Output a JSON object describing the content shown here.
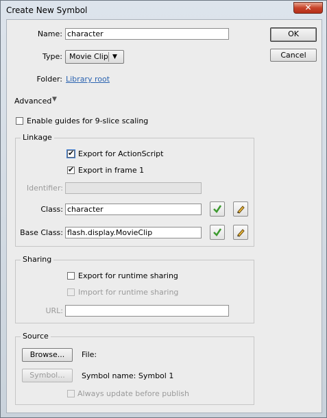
{
  "window": {
    "title": "Create New Symbol",
    "close_label": "✕"
  },
  "buttons": {
    "ok": "OK",
    "cancel": "Cancel"
  },
  "form": {
    "name_label": "Name:",
    "name_value": "character",
    "type_label": "Type:",
    "type_value": "Movie Clip",
    "folder_label": "Folder:",
    "folder_value": "Library root"
  },
  "advanced": {
    "label": "Advanced",
    "nine_slice": "Enable guides for 9-slice scaling"
  },
  "linkage": {
    "title": "Linkage",
    "export_actionscript": "Export for ActionScript",
    "export_frame1": "Export in frame 1",
    "identifier_label": "Identifier:",
    "identifier_value": "",
    "class_label": "Class:",
    "class_value": "character",
    "base_class_label": "Base Class:",
    "base_class_value": "flash.display.MovieClip"
  },
  "sharing": {
    "title": "Sharing",
    "export_runtime": "Export for runtime sharing",
    "import_runtime": "Import for runtime sharing",
    "url_label": "URL:",
    "url_value": ""
  },
  "source": {
    "title": "Source",
    "browse_label": "Browse...",
    "file_label": "File:",
    "symbol_label": "Symbol...",
    "symbol_name": "Symbol name: Symbol 1",
    "always_update": "Always update before publish"
  },
  "colors": {
    "accent": "#2b63b0",
    "check_green": "#3d9a2f",
    "close_red": "#c7432a"
  }
}
